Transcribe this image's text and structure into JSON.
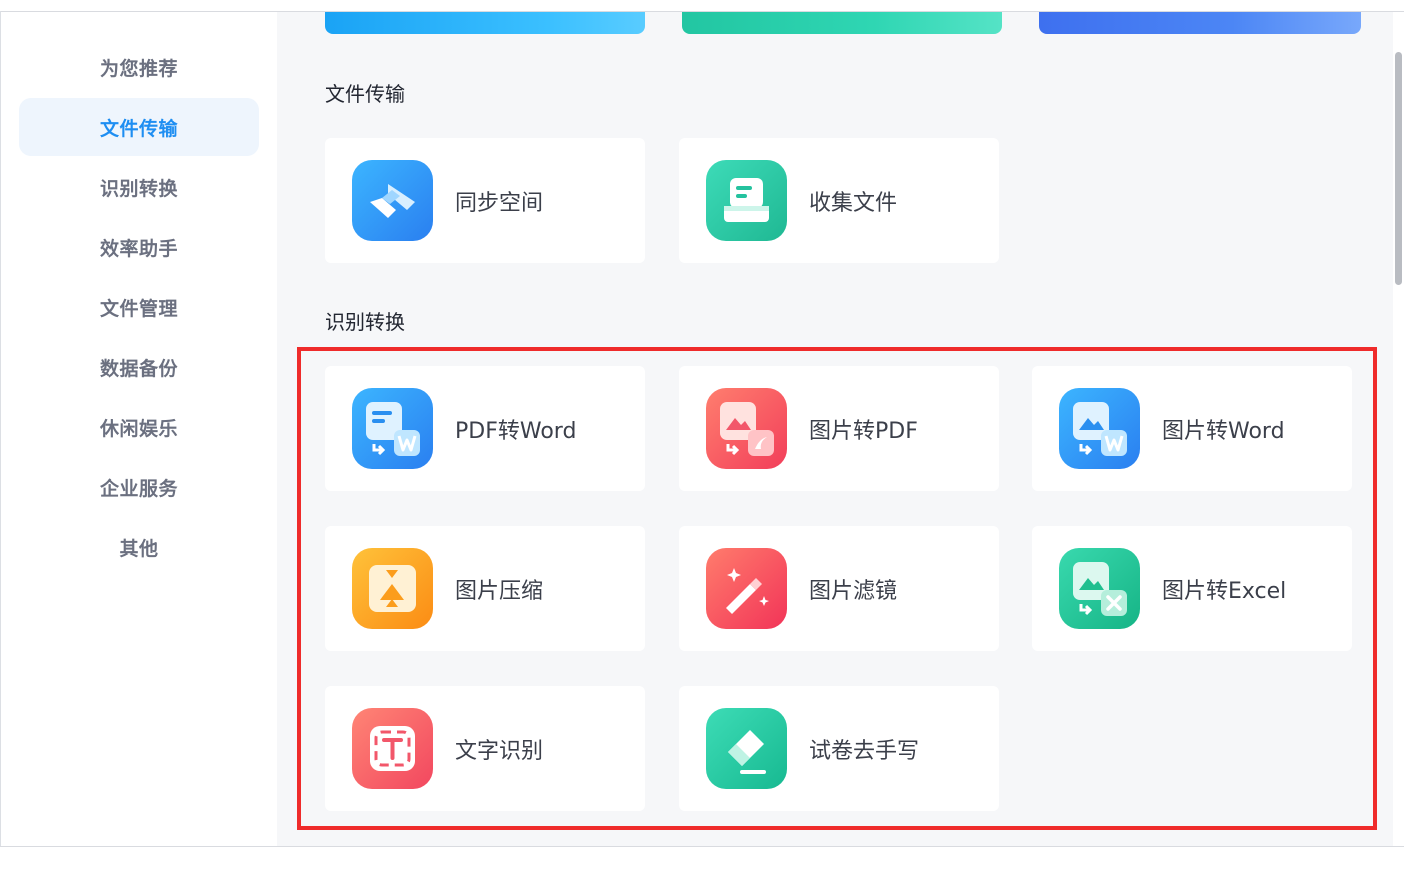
{
  "sidebar": {
    "items": [
      {
        "label": "为您推荐",
        "active": false
      },
      {
        "label": "文件传输",
        "active": true
      },
      {
        "label": "识别转换",
        "active": false
      },
      {
        "label": "效率助手",
        "active": false
      },
      {
        "label": "文件管理",
        "active": false
      },
      {
        "label": "数据备份",
        "active": false
      },
      {
        "label": "休闲娱乐",
        "active": false
      },
      {
        "label": "企业服务",
        "active": false
      },
      {
        "label": "其他",
        "active": false
      }
    ]
  },
  "sections": [
    {
      "title": "文件传输",
      "cards": [
        {
          "label": "同步空间",
          "icon": "sync-space-icon",
          "color": "#2f8ff2"
        },
        {
          "label": "收集文件",
          "icon": "collect-files-icon",
          "color": "#25c8a4"
        }
      ]
    },
    {
      "title": "识别转换",
      "cards": [
        {
          "label": "PDF转Word",
          "icon": "pdf-to-word-icon",
          "color": "#2f8ff2"
        },
        {
          "label": "图片转PDF",
          "icon": "image-to-pdf-icon",
          "color": "#f24f62"
        },
        {
          "label": "图片转Word",
          "icon": "image-to-word-icon",
          "color": "#2f8ff2"
        },
        {
          "label": "图片压缩",
          "icon": "image-compress-icon",
          "color": "#fb9d1c"
        },
        {
          "label": "图片滤镜",
          "icon": "image-filter-icon",
          "color": "#f4475e"
        },
        {
          "label": "图片转Excel",
          "icon": "image-to-excel-icon",
          "color": "#20c192"
        },
        {
          "label": "文字识别",
          "icon": "text-recognition-icon",
          "color": "#f4596a"
        },
        {
          "label": "试卷去手写",
          "icon": "remove-handwriting-icon",
          "color": "#20c7a0"
        }
      ]
    }
  ],
  "highlight_color": "#ef2b2b"
}
